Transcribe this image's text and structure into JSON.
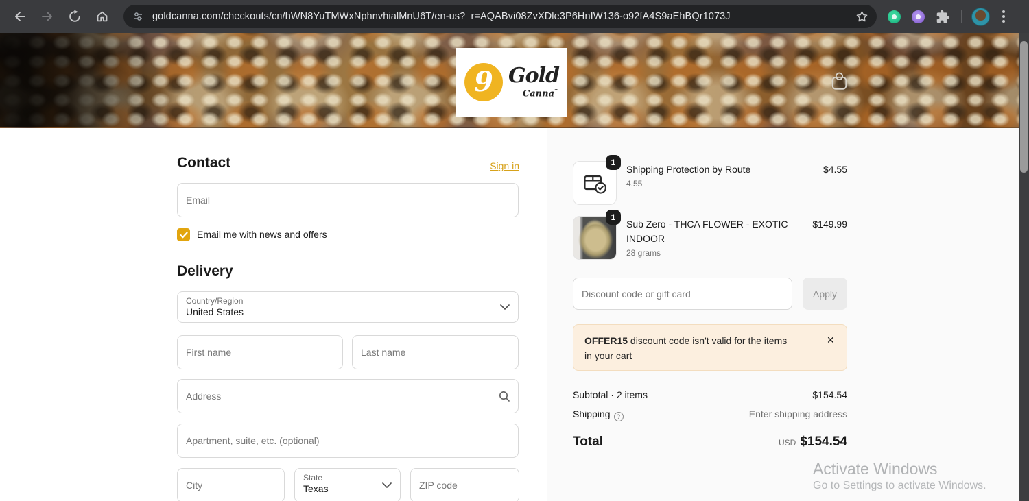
{
  "browser": {
    "url": "goldcanna.com/checkouts/cn/hWN8YuTMWxNphnvhialMnU6T/en-us?_r=AQABvi08ZvXDle3P6HnIW136-o92fA4S9aEhBQr1073J"
  },
  "header": {
    "logo": {
      "monogram": "9",
      "brand_top": "Gold",
      "brand_bottom": "Canna",
      "tm": "™"
    }
  },
  "checkout": {
    "contact": {
      "title": "Contact",
      "signin_label": "Sign in",
      "email_placeholder": "Email",
      "newsletter_label": "Email me with news and offers"
    },
    "delivery": {
      "title": "Delivery",
      "country_label": "Country/Region",
      "country_value": "United States",
      "first_name_placeholder": "First name",
      "last_name_placeholder": "Last name",
      "address_placeholder": "Address",
      "apartment_placeholder": "Apartment, suite, etc. (optional)",
      "city_placeholder": "City",
      "state_label": "State",
      "state_value": "Texas",
      "zip_placeholder": "ZIP code"
    }
  },
  "summary": {
    "items": [
      {
        "qty": "1",
        "title": "Shipping Protection by Route",
        "variant": "4.55",
        "price": "$4.55"
      },
      {
        "qty": "1",
        "title": "Sub Zero - THCA FLOWER - EXOTIC INDOOR",
        "variant": "28 grams",
        "price": "$149.99"
      }
    ],
    "discount": {
      "placeholder": "Discount code or gift card",
      "apply_label": "Apply"
    },
    "warning": {
      "code": "OFFER15",
      "text": " discount code isn't valid for the items in your cart",
      "close": "×"
    },
    "totals": {
      "subtotal_label": "Subtotal · 2 items",
      "subtotal_value": "$154.54",
      "shipping_label": "Shipping",
      "shipping_help": "?",
      "shipping_value": "Enter shipping address",
      "total_label": "Total",
      "currency": "USD",
      "total_value": "$154.54"
    }
  },
  "watermark": {
    "line1": "Activate Windows",
    "line2": "Go to Settings to activate Windows."
  },
  "colors": {
    "accent_gold": "#DFA511",
    "logo_gold": "#F0B421",
    "banner_bg": "#FCEFDF",
    "badge_dark": "#1C1C1C"
  }
}
